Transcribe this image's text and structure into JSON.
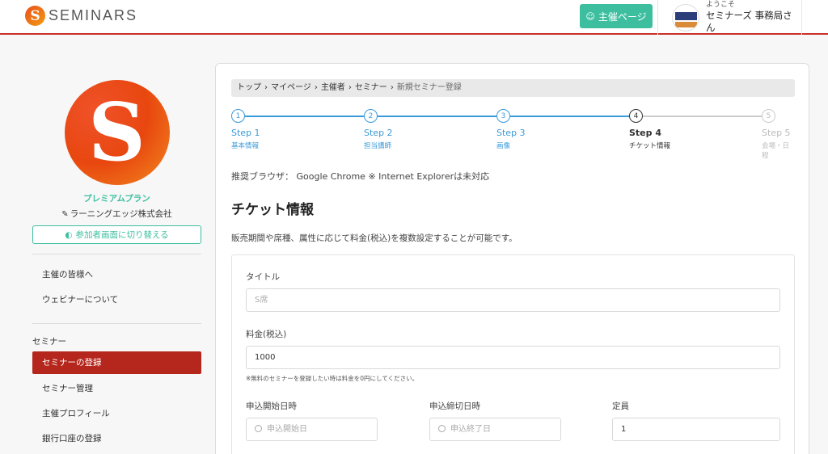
{
  "header": {
    "logo_letter": "S",
    "logo_text": "SEMINARS",
    "host_button": "主催ページ",
    "welcome": "ようこそ",
    "user_name": "セミナーズ 事務局さん"
  },
  "sidebar": {
    "avatar_letter": "S",
    "plan": "プレミアムプラン",
    "company": "ラーニングエッジ株式会社",
    "switch_button": "参加者画面に切り替える",
    "links": [
      "主催の皆様へ",
      "ウェビナーについて"
    ],
    "section_title": "セミナー",
    "items": [
      "セミナーの登録",
      "セミナー管理",
      "主催プロフィール",
      "銀行口座の登録"
    ]
  },
  "breadcrumb": {
    "items": [
      "トップ",
      "マイページ",
      "主催者",
      "セミナー"
    ],
    "current": "新規セミナー登録",
    "separator": "›"
  },
  "steps": [
    {
      "num": "1",
      "title": "Step 1",
      "sub": "基本情報",
      "state": "done"
    },
    {
      "num": "2",
      "title": "Step 2",
      "sub": "担当講師",
      "state": "done"
    },
    {
      "num": "3",
      "title": "Step 3",
      "sub": "画像",
      "state": "done"
    },
    {
      "num": "4",
      "title": "Step 4",
      "sub": "チケット情報",
      "state": "current"
    },
    {
      "num": "5",
      "title": "Step 5",
      "sub": "会場・日程",
      "state": "future"
    }
  ],
  "browser_note": "推奨ブラウザ： Google Chrome ※ Internet Explorerは未対応",
  "section_title": "チケット情報",
  "description": "販売期間や席種、属性に応じて料金(税込)を複数設定することが可能です。",
  "form": {
    "title_label": "タイトル",
    "title_placeholder": "S席",
    "price_label": "料金(税込)",
    "price_value": "1000",
    "price_note": "※無料のセミナーを登録したい時は料金を0円にしてください。",
    "start_label": "申込開始日時",
    "start_placeholder": "申込開始日",
    "end_label": "申込締切日時",
    "end_placeholder": "申込終了日",
    "capacity_label": "定員",
    "capacity_value": "1"
  }
}
